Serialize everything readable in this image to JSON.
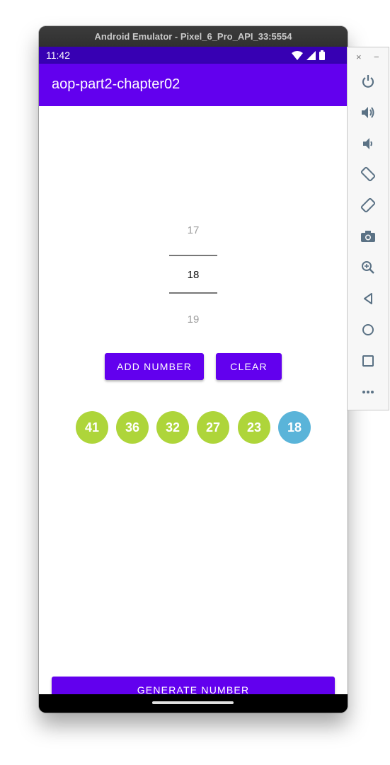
{
  "emulator": {
    "title": "Android Emulator - Pixel_6_Pro_API_33:5554",
    "controls": {
      "close": "×",
      "minimize": "−",
      "buttons": [
        "power-icon",
        "volume-up-icon",
        "volume-down-icon",
        "rotate-left-icon",
        "rotate-right-icon",
        "camera-icon",
        "zoom-icon",
        "back-icon",
        "home-icon",
        "overview-icon",
        "more-icon"
      ]
    }
  },
  "status_bar": {
    "time": "11:42"
  },
  "app_bar": {
    "title": "aop-part2-chapter02"
  },
  "number_picker": {
    "above": "17",
    "selected": "18",
    "below": "19"
  },
  "buttons": {
    "add": "ADD NUMBER",
    "clear": "CLEAR",
    "generate": "GENERATE NUMBER"
  },
  "balls": [
    {
      "value": "41",
      "color": "#aed53a"
    },
    {
      "value": "36",
      "color": "#aed53a"
    },
    {
      "value": "32",
      "color": "#aed53a"
    },
    {
      "value": "27",
      "color": "#aed53a"
    },
    {
      "value": "23",
      "color": "#aed53a"
    },
    {
      "value": "18",
      "color": "#5ab4d9"
    }
  ],
  "colors": {
    "primary": "#6200ee",
    "status": "#3700b3"
  }
}
